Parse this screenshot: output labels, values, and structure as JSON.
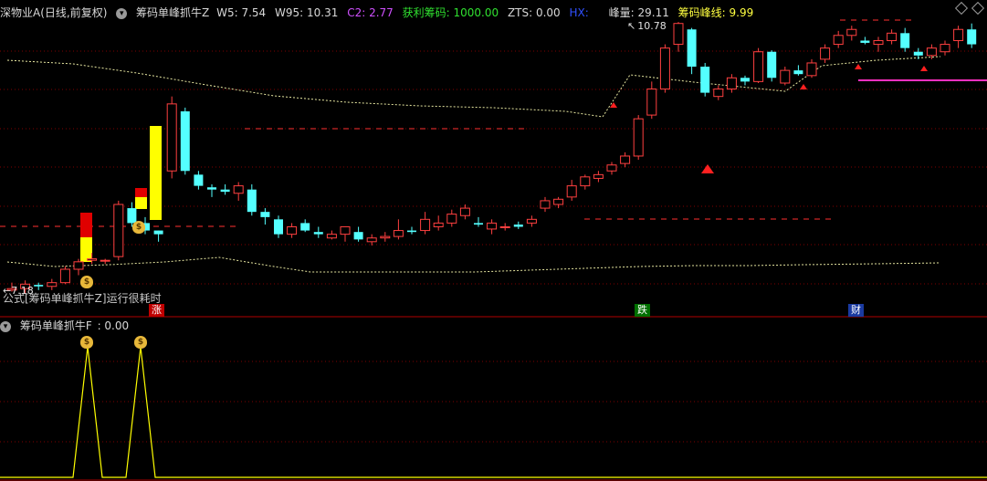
{
  "main_header": {
    "stock": "深物业A(日线,前复权)",
    "indicator": "筹码单峰抓牛Z",
    "w5": "W5: 7.54",
    "w95": "W95: 10.31",
    "c2": "C2: 2.77",
    "profit_chips": "获利筹码: 1000.00",
    "zts": "ZTS: 0.00",
    "hx": "HX: ",
    "peak": "峰量: 29.11",
    "peak_line": "筹码峰线: 9.99"
  },
  "labels": {
    "high_price": "10.78",
    "low_price": "7.18",
    "formula_msg": "公式[筹码单峰抓牛Z]运行很耗时",
    "zhang": "涨",
    "die": "跌",
    "cai": "财"
  },
  "sub_header": {
    "indicator": "筹码单峰抓牛F",
    "value": ": 0.00"
  },
  "colors": {
    "up": "#ff4040",
    "down": "#54ffff",
    "yellow": "#ffff00",
    "magenta": "#ff30c0",
    "grid": "#800000",
    "dashed": "#ff3030",
    "ma": "#e6e6a0"
  },
  "candles": [
    [
      7.2,
      7.3,
      7.18,
      7.22
    ],
    [
      7.22,
      7.33,
      7.15,
      7.28
    ],
    [
      7.27,
      7.3,
      7.2,
      7.25
    ],
    [
      7.25,
      7.35,
      7.2,
      7.3
    ],
    [
      7.3,
      7.52,
      7.28,
      7.48
    ],
    [
      7.48,
      7.62,
      7.4,
      7.58
    ],
    [
      7.6,
      7.7,
      7.55,
      7.62
    ],
    [
      7.6,
      7.62,
      7.55,
      7.6
    ],
    [
      7.65,
      8.4,
      7.6,
      8.35
    ],
    [
      8.3,
      8.38,
      8.05,
      8.1
    ],
    [
      8.1,
      8.18,
      7.95,
      8.0
    ],
    [
      8.0,
      8.0,
      7.85,
      7.95
    ],
    [
      8.8,
      9.8,
      8.7,
      9.7
    ],
    [
      9.6,
      9.65,
      8.75,
      8.8
    ],
    [
      8.75,
      8.8,
      8.55,
      8.6
    ],
    [
      8.58,
      8.62,
      8.45,
      8.55
    ],
    [
      8.55,
      8.62,
      8.48,
      8.52
    ],
    [
      8.5,
      8.65,
      8.4,
      8.6
    ],
    [
      8.55,
      8.62,
      8.2,
      8.25
    ],
    [
      8.25,
      8.3,
      8.08,
      8.18
    ],
    [
      8.15,
      8.2,
      7.9,
      7.95
    ],
    [
      7.95,
      8.1,
      7.9,
      8.05
    ],
    [
      8.1,
      8.15,
      7.98,
      8.0
    ],
    [
      7.98,
      8.05,
      7.9,
      7.95
    ],
    [
      7.9,
      8.0,
      7.88,
      7.95
    ],
    [
      7.95,
      8.05,
      7.85,
      8.05
    ],
    [
      7.98,
      8.05,
      7.85,
      7.88
    ],
    [
      7.85,
      7.95,
      7.8,
      7.9
    ],
    [
      7.9,
      7.98,
      7.85,
      7.92
    ],
    [
      7.92,
      8.15,
      7.88,
      8.0
    ],
    [
      8.0,
      8.05,
      7.95,
      7.98
    ],
    [
      8.0,
      8.25,
      7.95,
      8.15
    ],
    [
      8.05,
      8.2,
      8.0,
      8.1
    ],
    [
      8.1,
      8.28,
      8.05,
      8.22
    ],
    [
      8.2,
      8.35,
      8.15,
      8.3
    ],
    [
      8.1,
      8.18,
      8.05,
      8.08
    ],
    [
      8.02,
      8.15,
      7.95,
      8.1
    ],
    [
      8.05,
      8.1,
      8.0,
      8.05
    ],
    [
      8.08,
      8.12,
      8.02,
      8.05
    ],
    [
      8.1,
      8.2,
      8.05,
      8.15
    ],
    [
      8.3,
      8.45,
      8.25,
      8.4
    ],
    [
      8.35,
      8.45,
      8.3,
      8.42
    ],
    [
      8.45,
      8.68,
      8.4,
      8.6
    ],
    [
      8.6,
      8.75,
      8.55,
      8.72
    ],
    [
      8.7,
      8.8,
      8.65,
      8.75
    ],
    [
      8.8,
      8.92,
      8.75,
      8.88
    ],
    [
      8.9,
      9.05,
      8.85,
      9.0
    ],
    [
      9.0,
      9.55,
      8.95,
      9.5
    ],
    [
      9.55,
      10.0,
      9.5,
      9.9
    ],
    [
      9.9,
      10.5,
      9.85,
      10.45
    ],
    [
      10.5,
      10.8,
      10.4,
      10.78
    ],
    [
      10.7,
      10.72,
      10.1,
      10.2
    ],
    [
      10.2,
      10.25,
      9.8,
      9.85
    ],
    [
      9.8,
      9.95,
      9.75,
      9.9
    ],
    [
      9.9,
      10.1,
      9.85,
      10.05
    ],
    [
      10.05,
      10.08,
      9.95,
      10.0
    ],
    [
      10.0,
      10.45,
      9.98,
      10.4
    ],
    [
      10.4,
      10.42,
      10.0,
      10.05
    ],
    [
      9.98,
      10.2,
      9.95,
      10.15
    ],
    [
      10.15,
      10.22,
      10.08,
      10.1
    ],
    [
      10.08,
      10.3,
      10.05,
      10.25
    ],
    [
      10.3,
      10.5,
      10.25,
      10.45
    ],
    [
      10.5,
      10.68,
      10.45,
      10.62
    ],
    [
      10.62,
      10.75,
      10.55,
      10.7
    ],
    [
      10.55,
      10.6,
      10.5,
      10.52
    ],
    [
      10.5,
      10.6,
      10.4,
      10.55
    ],
    [
      10.55,
      10.7,
      10.5,
      10.65
    ],
    [
      10.65,
      10.72,
      10.4,
      10.45
    ],
    [
      10.4,
      10.45,
      10.3,
      10.35
    ],
    [
      10.35,
      10.5,
      10.3,
      10.45
    ],
    [
      10.4,
      10.55,
      10.35,
      10.5
    ],
    [
      10.55,
      10.75,
      10.45,
      10.7
    ],
    [
      10.7,
      10.78,
      10.45,
      10.5
    ]
  ]
}
